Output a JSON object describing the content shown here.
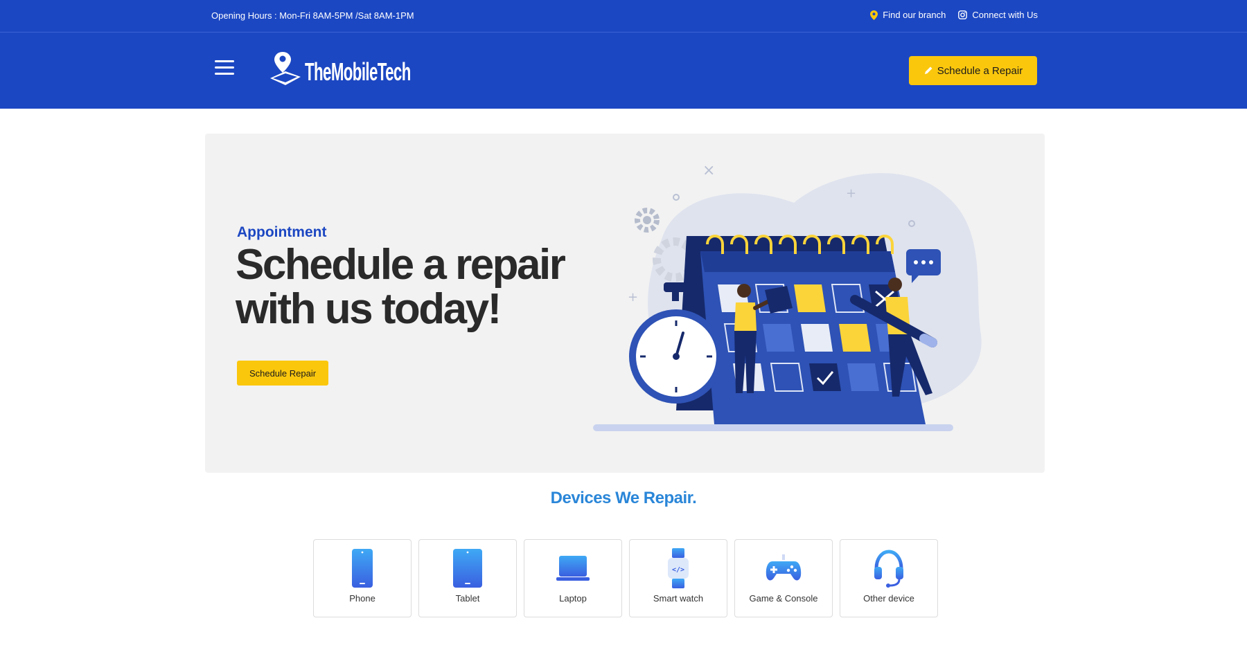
{
  "topbar": {
    "hours": "Opening Hours : Mon-Fri 8AM-5PM /Sat 8AM-1PM",
    "find_branch": "Find our branch",
    "connect": "Connect with Us",
    "icons": [
      "map-pin-icon",
      "instagram-icon"
    ]
  },
  "header": {
    "logo_text": "TheMobileTech",
    "cta_label": "Schedule a Repair",
    "icons": [
      "hamburger-menu-icon",
      "logo-mark-icon",
      "pencil-icon"
    ]
  },
  "hero": {
    "eyebrow": "Appointment",
    "headline": "Schedule a repair with us today!",
    "cta_label": "Schedule Repair"
  },
  "devices": {
    "title": "Devices We Repair.",
    "items": [
      {
        "label": "Phone",
        "icon": "phone-icon"
      },
      {
        "label": "Tablet",
        "icon": "tablet-icon"
      },
      {
        "label": "Laptop",
        "icon": "laptop-icon"
      },
      {
        "label": "Smart watch",
        "icon": "smartwatch-icon"
      },
      {
        "label": "Game & Console",
        "icon": "gamepad-icon"
      },
      {
        "label": "Other device",
        "icon": "headset-icon"
      }
    ]
  },
  "colors": {
    "brand_blue": "#1c47c2",
    "accent_yellow": "#fbc70d",
    "title_blue": "#2a86d8",
    "hero_bg": "#f2f2f2"
  }
}
